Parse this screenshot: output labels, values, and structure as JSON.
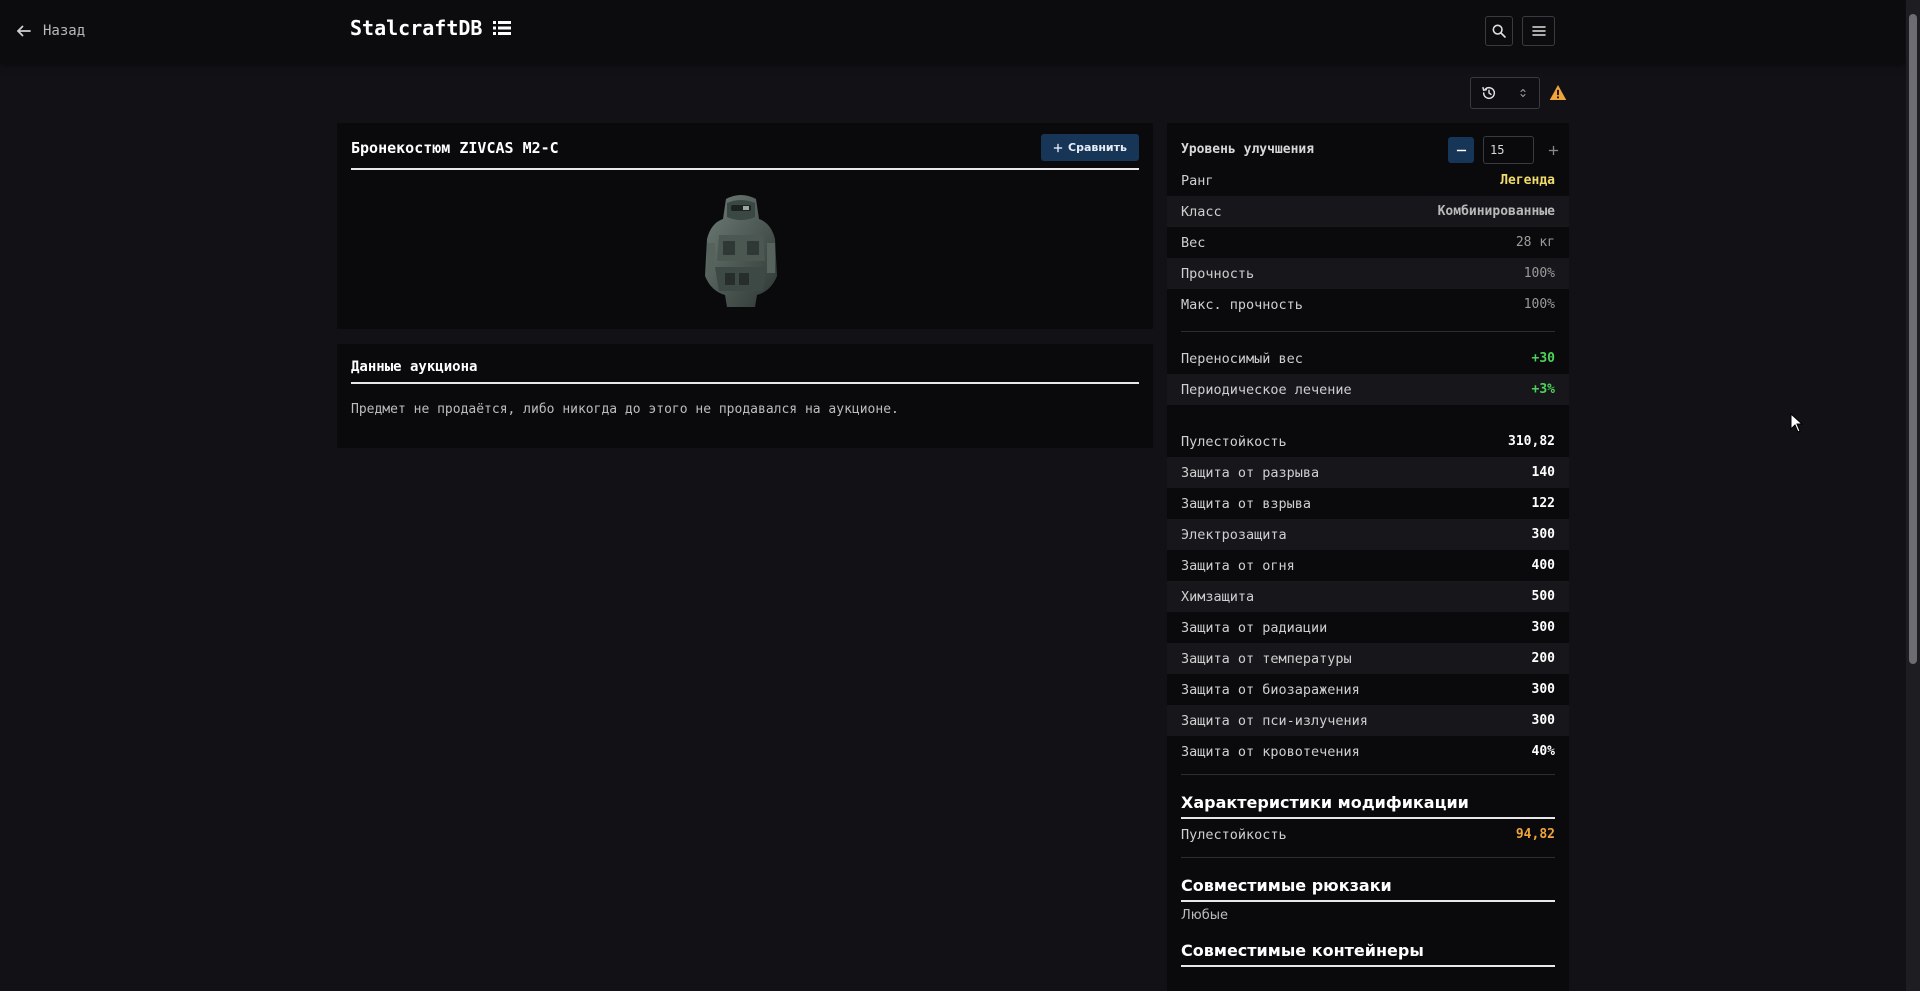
{
  "header": {
    "back_label": "Назад",
    "brand": "StalcraftDB"
  },
  "item": {
    "title": "Бронекостюм ZIVCAS M2-C",
    "compare_label": "Сравнить",
    "image_icon": "armor-suit-icon"
  },
  "auction": {
    "title": "Данные аукциона",
    "text": "Предмет не продаётся, либо никогда до этого не продавался на аукционе."
  },
  "upgrade": {
    "label": "Уровень улучшения",
    "value": "15"
  },
  "stats_basic": [
    {
      "label": "Ранг",
      "value": "Легенда"
    },
    {
      "label": "Класс",
      "value": "Комбинированные"
    },
    {
      "label": "Вес",
      "value": "28 кг"
    },
    {
      "label": "Прочность",
      "value": "100%"
    },
    {
      "label": "Макс. прочность",
      "value": "100%"
    }
  ],
  "stats_bonus": [
    {
      "label": "Переносимый вес",
      "value": "+30"
    },
    {
      "label": "Периодическое лечение",
      "value": "+3%"
    }
  ],
  "stats_protection": [
    {
      "label": "Пулестойкость",
      "value": "310,82"
    },
    {
      "label": "Защита от разрыва",
      "value": "140"
    },
    {
      "label": "Защита от взрыва",
      "value": "122"
    },
    {
      "label": "Электрозащита",
      "value": "300"
    },
    {
      "label": "Защита от огня",
      "value": "400"
    },
    {
      "label": "Химзащита",
      "value": "500"
    },
    {
      "label": "Защита от радиации",
      "value": "300"
    },
    {
      "label": "Защита от температуры",
      "value": "200"
    },
    {
      "label": "Защита от биозаражения",
      "value": "300"
    },
    {
      "label": "Защита от пси-излучения",
      "value": "300"
    },
    {
      "label": "Защита от кровотечения",
      "value": "40%"
    }
  ],
  "mod_section": {
    "title": "Характеристики модификации",
    "rows": [
      {
        "label": "Пулестойкость",
        "value": "94,82"
      }
    ]
  },
  "backpacks": {
    "title": "Совместимые рюкзаки",
    "text": "Любые"
  },
  "containers": {
    "title": "Совместимые контейнеры"
  },
  "colors": {
    "accent": "#173556",
    "legend_rank": "#f1dc6a",
    "positive": "#4cd35a",
    "mod_value": "#f0a43a",
    "warning": "#f0a43a"
  }
}
